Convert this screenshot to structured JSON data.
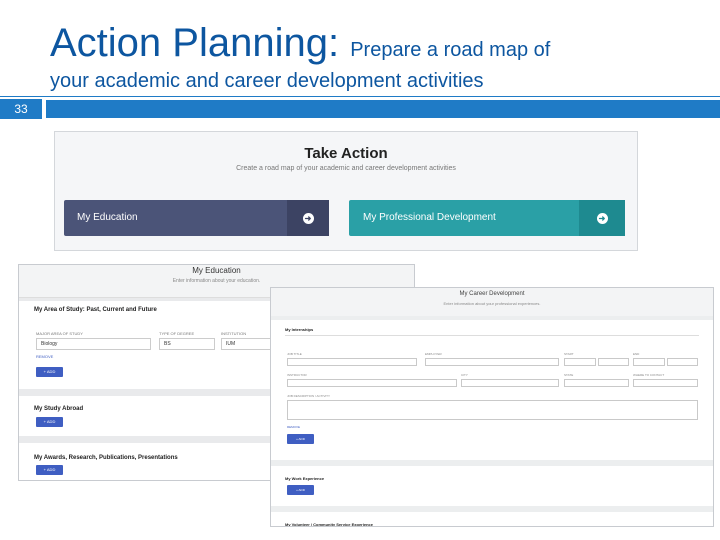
{
  "slide": {
    "title_main": "Action Planning: ",
    "title_sub": "Prepare a road map of",
    "title_line2": "your academic and career development activities",
    "number": "33"
  },
  "take_action": {
    "title": "Take Action",
    "subtitle": "Create a road map of your academic and career development activities",
    "education_label": "My Education",
    "professional_label": "My Professional Development",
    "arrow_icon": "arrow-right-circle"
  },
  "education": {
    "header": "My Education",
    "header_sub": "Enter information about your education.",
    "area_title": "My Area of Study: Past, Current and Future",
    "field_labels": [
      "MAJOR AREA OF STUDY",
      "TYPE OF DEGREE",
      "INSTITUTION"
    ],
    "field_values": [
      "Biology",
      "BS",
      "IUM"
    ],
    "remove_link": "REMOVE",
    "add_label": "+ ADD",
    "study_abroad_title": "My Study Abroad",
    "awards_title": "My Awards, Research, Publications, Presentations"
  },
  "career": {
    "header": "My Career Development",
    "header_sub": "Enter information about your professional experiences.",
    "internships_title": "My Internships",
    "row1_labels": [
      "JOB TITLE",
      "EMPLOYER",
      "START",
      "END"
    ],
    "row2_labels": [
      "INSTRUCTOR",
      "CITY",
      "STATE",
      "WHERE TO CONTACT"
    ],
    "desc_label": "JOB DESCRIPTION / ACTIVITY",
    "remove_link": "REMOVE",
    "add_label": "+ ADD",
    "work_title": "My Work Experience",
    "volunteer_title": "My Volunteer / Community Service Experience"
  },
  "colors": {
    "title_blue": "#0d56a0",
    "rule_blue": "#1f7bc6",
    "education_button": "#4b5478",
    "professional_button": "#2aa0a6",
    "add_button": "#3f5ec2"
  }
}
